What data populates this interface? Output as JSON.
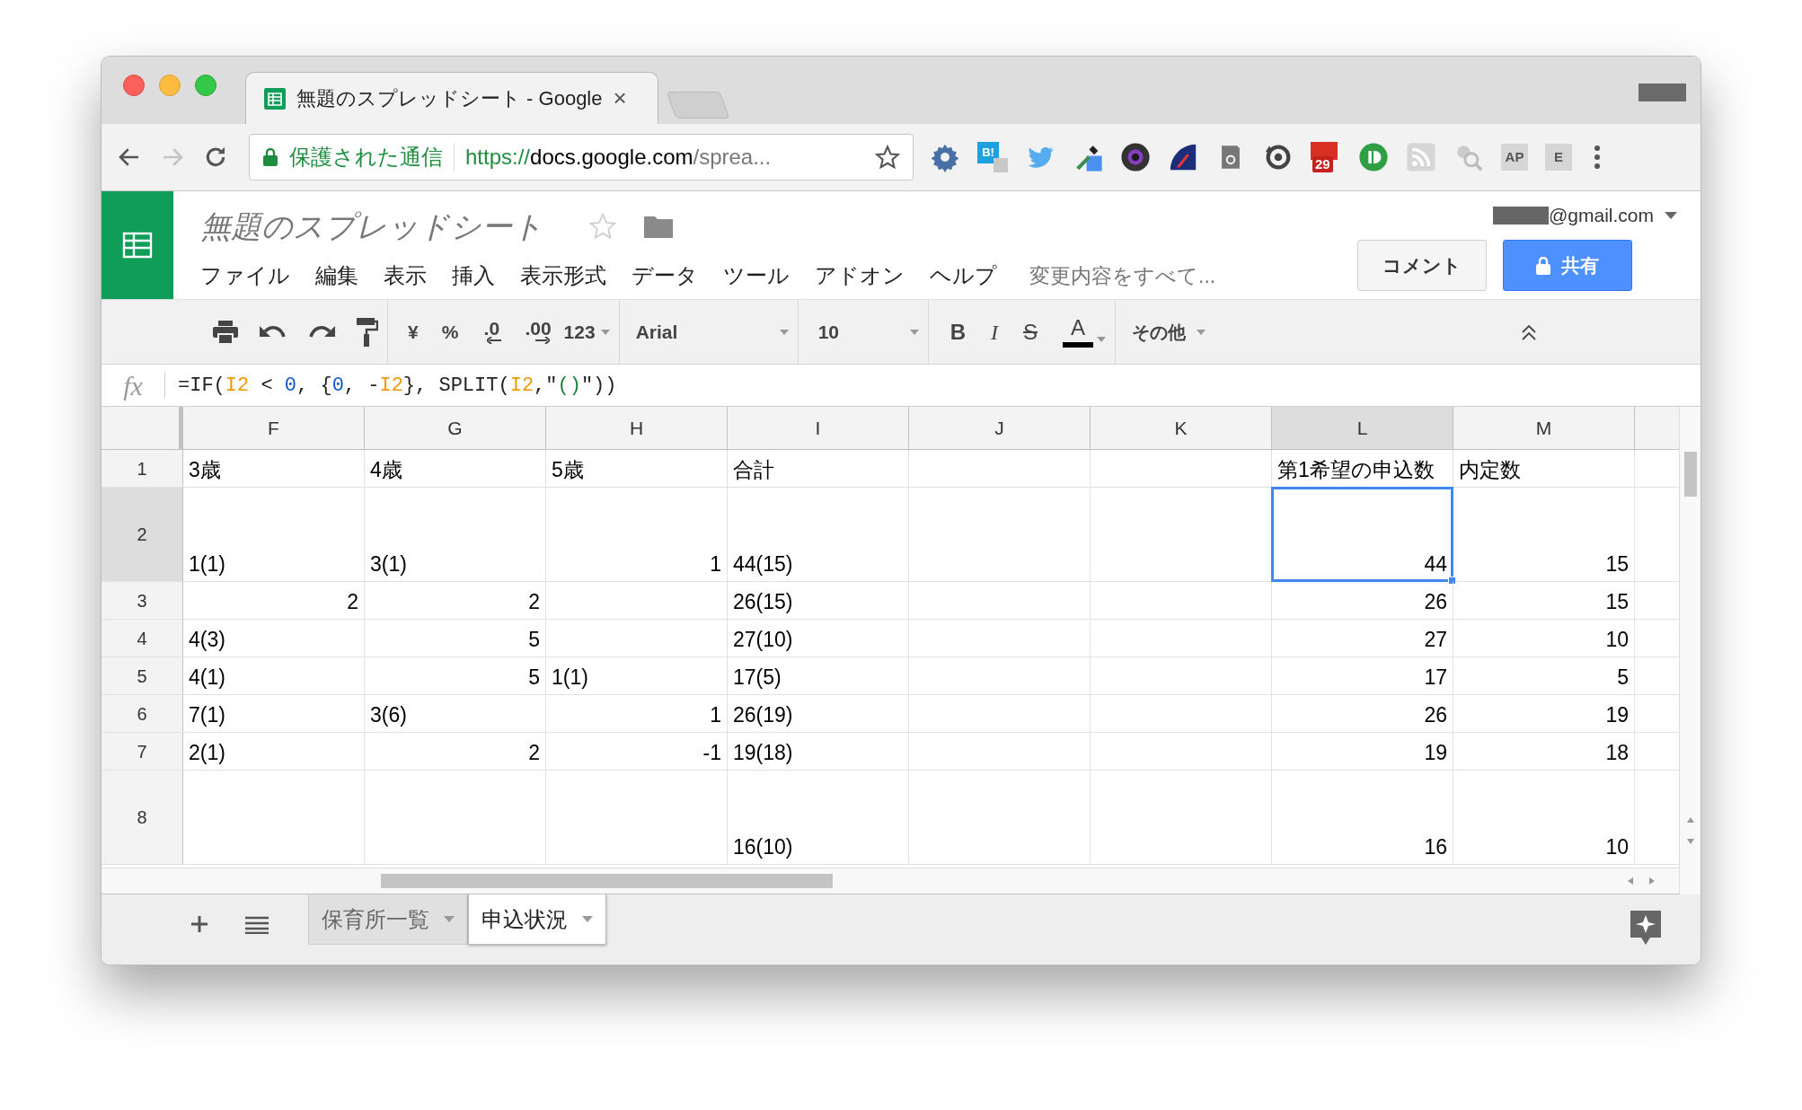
{
  "browser": {
    "tab": {
      "title": "無題のスプレッドシート - Google",
      "close": "×"
    },
    "security": "保護された通信",
    "url": {
      "scheme": "https://",
      "host": "docs.google.com",
      "path": "/sprea..."
    },
    "extensions": [
      {
        "kind": "gear"
      },
      {
        "kind": "letter",
        "label": "B!"
      },
      {
        "kind": "bird"
      },
      {
        "kind": "dropper"
      },
      {
        "kind": "lens"
      },
      {
        "kind": "gauge"
      },
      {
        "kind": "mail"
      },
      {
        "kind": "sync"
      },
      {
        "kind": "calendar",
        "label": "29"
      },
      {
        "kind": "green-circle"
      },
      {
        "kind": "rss"
      },
      {
        "kind": "search"
      },
      {
        "kind": "faded-letter",
        "label": "AP"
      },
      {
        "kind": "faded-letter",
        "label": "E"
      }
    ]
  },
  "doc": {
    "title": "無題のスプレッドシート",
    "account": "@gmail.com",
    "menu": [
      "ファイル",
      "編集",
      "表示",
      "挿入",
      "表示形式",
      "データ",
      "ツール",
      "アドオン",
      "ヘルプ"
    ],
    "save_status": "変更内容をすべて...",
    "comment_button": "コメント",
    "share_button": "共有"
  },
  "toolbar": {
    "currency": "¥",
    "percent": "%",
    "decrease_decimals": ".0",
    "increase_decimals": ".00",
    "number_format": "123",
    "font": "Arial",
    "font_size": "10",
    "bold": "B",
    "italic": "I",
    "strike": "S",
    "text_color": "A",
    "more": "その他"
  },
  "formula": {
    "label": "fx",
    "tokens": [
      {
        "kind": "text",
        "text": "=IF("
      },
      {
        "kind": "ref",
        "text": "I2"
      },
      {
        "kind": "text",
        "text": " < "
      },
      {
        "kind": "number",
        "text": "0"
      },
      {
        "kind": "text",
        "text": ", {"
      },
      {
        "kind": "number",
        "text": "0"
      },
      {
        "kind": "text",
        "text": ", -"
      },
      {
        "kind": "ref",
        "text": "I2"
      },
      {
        "kind": "text",
        "text": "}, SPLIT("
      },
      {
        "kind": "ref",
        "text": "I2"
      },
      {
        "kind": "text",
        "text": ",\""
      },
      {
        "kind": "string",
        "text": "()"
      },
      {
        "kind": "text",
        "text": "\"))"
      }
    ]
  },
  "sheet": {
    "columns": [
      {
        "label": "F",
        "selected": false
      },
      {
        "label": "G",
        "selected": false
      },
      {
        "label": "H",
        "selected": false
      },
      {
        "label": "I",
        "selected": false
      },
      {
        "label": "J",
        "selected": false
      },
      {
        "label": "K",
        "selected": false
      },
      {
        "label": "L",
        "selected": true
      },
      {
        "label": "M",
        "selected": false
      }
    ],
    "rows": [
      {
        "number": "1",
        "selected": false,
        "kind": "normal",
        "cells": [
          {
            "text": "3歳",
            "kind": "text"
          },
          {
            "text": "4歳",
            "kind": "text"
          },
          {
            "text": "5歳",
            "kind": "text"
          },
          {
            "text": "合計",
            "kind": "text"
          },
          null,
          null,
          {
            "text": "第1希望の申込数",
            "kind": "text"
          },
          {
            "text": "内定数",
            "kind": "text"
          }
        ]
      },
      {
        "number": "2",
        "selected": true,
        "kind": "tall",
        "cells": [
          {
            "text": "1(1)",
            "kind": "text"
          },
          {
            "text": "3(1)",
            "kind": "text"
          },
          {
            "text": "1",
            "kind": "number"
          },
          {
            "text": "44(15)",
            "kind": "text"
          },
          null,
          null,
          {
            "text": "44",
            "kind": "number"
          },
          {
            "text": "15",
            "kind": "number"
          }
        ]
      },
      {
        "number": "3",
        "selected": false,
        "kind": "normal",
        "cells": [
          {
            "text": "2",
            "kind": "number"
          },
          {
            "text": "2",
            "kind": "number"
          },
          null,
          {
            "text": "26(15)",
            "kind": "text"
          },
          null,
          null,
          {
            "text": "26",
            "kind": "number"
          },
          {
            "text": "15",
            "kind": "number"
          }
        ]
      },
      {
        "number": "4",
        "selected": false,
        "kind": "normal",
        "cells": [
          {
            "text": "4(3)",
            "kind": "text"
          },
          {
            "text": "5",
            "kind": "number"
          },
          null,
          {
            "text": "27(10)",
            "kind": "text"
          },
          null,
          null,
          {
            "text": "27",
            "kind": "number"
          },
          {
            "text": "10",
            "kind": "number"
          }
        ]
      },
      {
        "number": "5",
        "selected": false,
        "kind": "normal",
        "cells": [
          {
            "text": "4(1)",
            "kind": "text"
          },
          {
            "text": "5",
            "kind": "number"
          },
          {
            "text": "1(1)",
            "kind": "text"
          },
          {
            "text": "17(5)",
            "kind": "text"
          },
          null,
          null,
          {
            "text": "17",
            "kind": "number"
          },
          {
            "text": "5",
            "kind": "number"
          }
        ]
      },
      {
        "number": "6",
        "selected": false,
        "kind": "normal",
        "cells": [
          {
            "text": "7(1)",
            "kind": "text"
          },
          {
            "text": "3(6)",
            "kind": "text"
          },
          {
            "text": "1",
            "kind": "number"
          },
          {
            "text": "26(19)",
            "kind": "text"
          },
          null,
          null,
          {
            "text": "26",
            "kind": "number"
          },
          {
            "text": "19",
            "kind": "number"
          }
        ]
      },
      {
        "number": "7",
        "selected": false,
        "kind": "normal",
        "cells": [
          {
            "text": "2(1)",
            "kind": "text"
          },
          {
            "text": "2",
            "kind": "number"
          },
          {
            "text": "-1",
            "kind": "number"
          },
          {
            "text": "19(18)",
            "kind": "text"
          },
          null,
          null,
          {
            "text": "19",
            "kind": "number"
          },
          {
            "text": "18",
            "kind": "number"
          }
        ]
      },
      {
        "number": "8",
        "selected": false,
        "kind": "tall",
        "cells": [
          null,
          null,
          null,
          {
            "text": "16(10)",
            "kind": "text"
          },
          null,
          null,
          {
            "text": "16",
            "kind": "number"
          },
          {
            "text": "10",
            "kind": "number"
          }
        ]
      }
    ],
    "tabs": [
      {
        "label": "保育所一覧",
        "selected": false
      },
      {
        "label": "申込状況",
        "selected": true
      }
    ]
  }
}
